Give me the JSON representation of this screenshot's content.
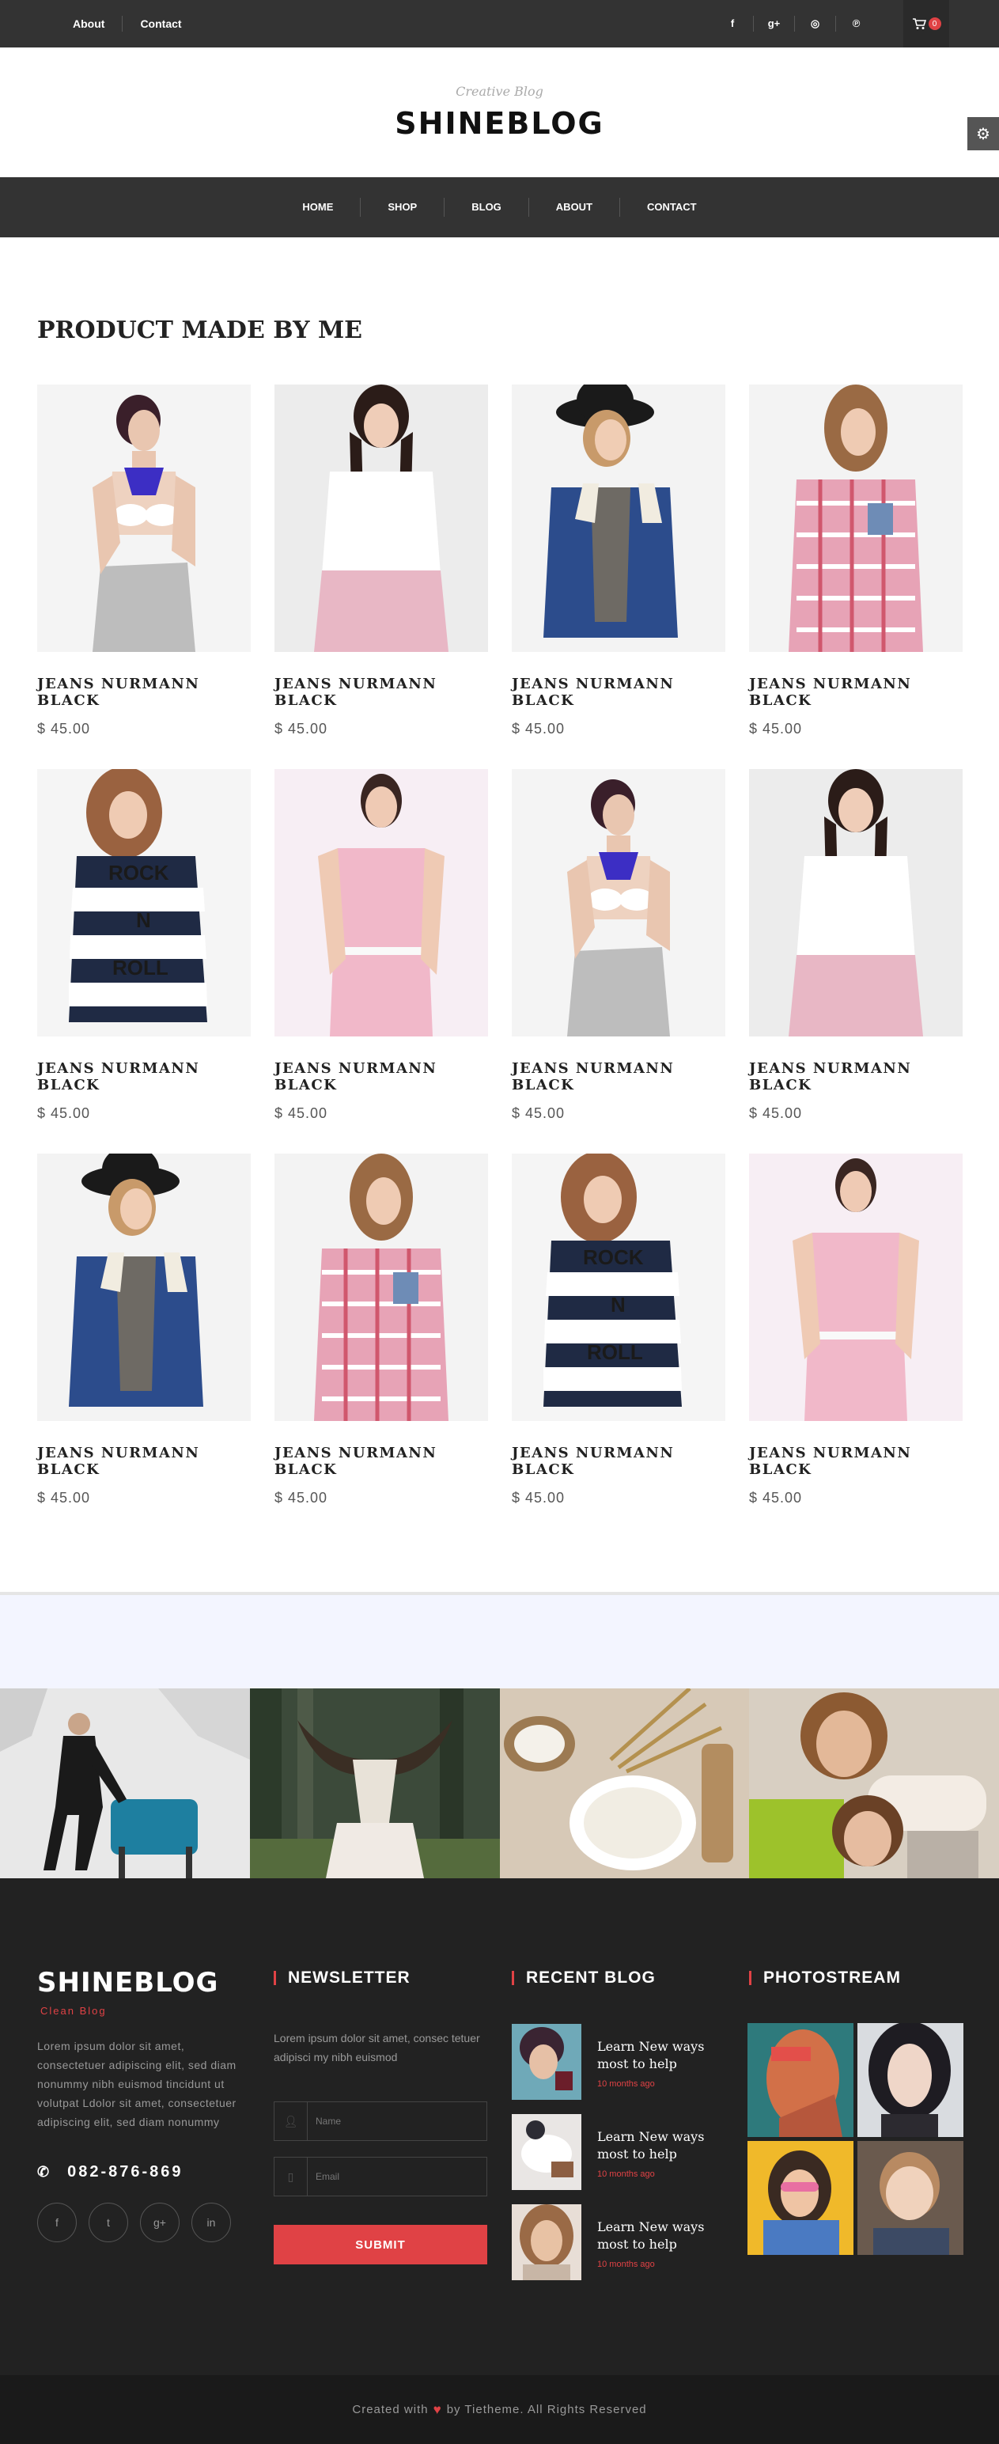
{
  "topbar": {
    "links": [
      "About",
      "Contact"
    ],
    "social": [
      "f",
      "g+",
      "d",
      "p"
    ],
    "cart_count": "0"
  },
  "header": {
    "tagline": "Creative Blog",
    "logo": "SHINEBLOG"
  },
  "nav": [
    "HOME",
    "SHOP",
    "BLOG",
    "ABOUT",
    "CONTACT"
  ],
  "products": {
    "title": "PRODUCT MADE BY ME",
    "items": [
      {
        "name": "JEANS NURMANN BLACK",
        "price": "$ 45.00",
        "look": "bikini"
      },
      {
        "name": "JEANS NURMANN BLACK",
        "price": "$ 45.00",
        "look": "white-shirt"
      },
      {
        "name": "JEANS NURMANN BLACK",
        "price": "$ 45.00",
        "look": "denim-hat"
      },
      {
        "name": "JEANS NURMANN BLACK",
        "price": "$ 45.00",
        "look": "plaid"
      },
      {
        "name": "JEANS NURMANN BLACK",
        "price": "$ 45.00",
        "look": "stripes"
      },
      {
        "name": "JEANS NURMANN BLACK",
        "price": "$ 45.00",
        "look": "pink-dress"
      },
      {
        "name": "JEANS NURMANN BLACK",
        "price": "$ 45.00",
        "look": "bikini"
      },
      {
        "name": "JEANS NURMANN BLACK",
        "price": "$ 45.00",
        "look": "white-shirt"
      },
      {
        "name": "JEANS NURMANN BLACK",
        "price": "$ 45.00",
        "look": "denim-hat"
      },
      {
        "name": "JEANS NURMANN BLACK",
        "price": "$ 45.00",
        "look": "plaid"
      },
      {
        "name": "JEANS NURMANN BLACK",
        "price": "$ 45.00",
        "look": "stripes"
      },
      {
        "name": "JEANS NURMANN BLACK",
        "price": "$ 45.00",
        "look": "pink-dress"
      }
    ]
  },
  "footer": {
    "logo": "SHINEBLOG",
    "subtitle": "Clean Blog",
    "about": "Lorem ipsum dolor sit amet, consectetuer adipiscing elit, sed diam nonummy nibh euismod tincidunt ut volutpat Ldolor sit amet, consectetuer adipiscing elit, sed diam nonummy",
    "phone": "082-876-869",
    "social": [
      "f",
      "t",
      "g+",
      "in"
    ],
    "newsletter": {
      "heading": "NEWSLETTER",
      "text": "Lorem ipsum dolor sit amet, consec tetuer adipisci my nibh euismod",
      "name_placeholder": "Name",
      "email_placeholder": "Email",
      "submit": "SUBMIT"
    },
    "recent_blog": {
      "heading": "RECENT BLOG",
      "items": [
        {
          "title": "Learn New ways most to help",
          "date": "10 months ago"
        },
        {
          "title": "Learn New ways most to help",
          "date": "10 months ago"
        },
        {
          "title": "Learn New ways most to help",
          "date": "10 months ago"
        }
      ]
    },
    "photostream": {
      "heading": "PHOTOSTREAM"
    }
  },
  "copyright": {
    "before": "Created with",
    "after": "by Tietheme. All Rights Reserved"
  }
}
